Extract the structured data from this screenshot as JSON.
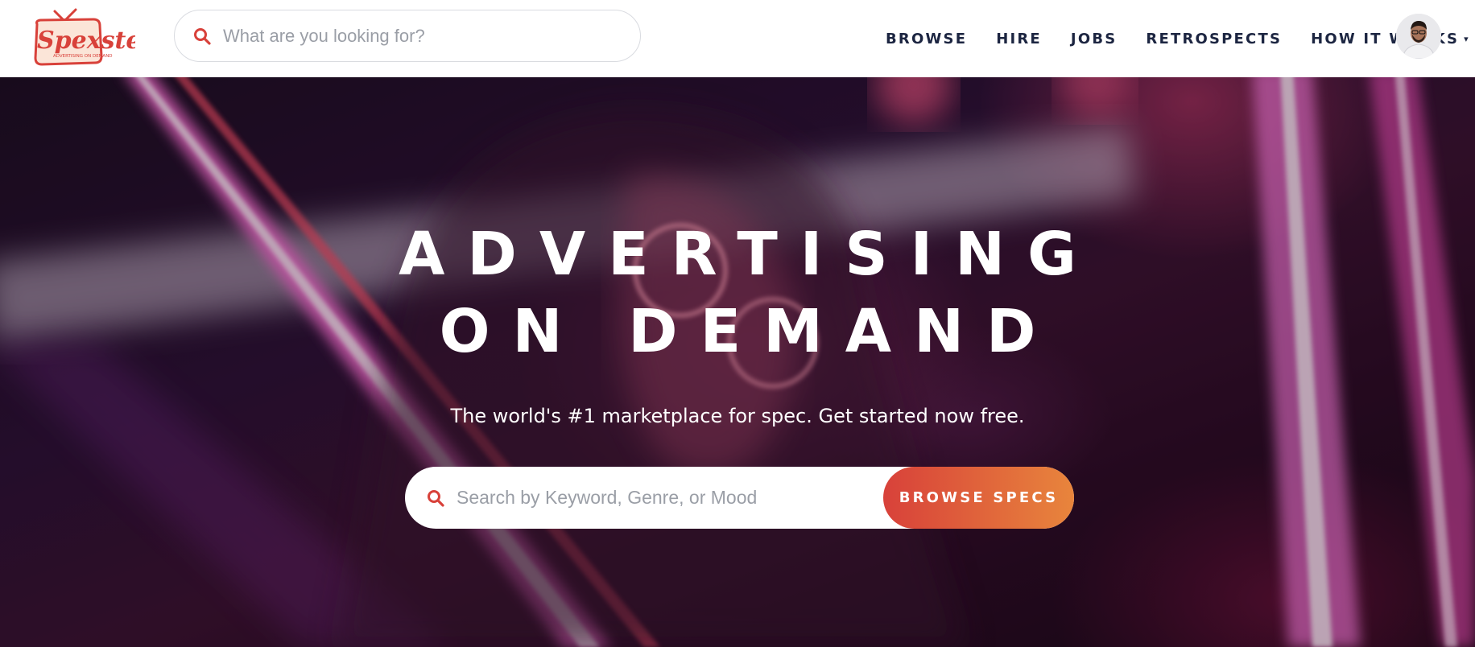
{
  "brand": {
    "name": "Spexster",
    "tagline": "ADVERTISING ON DEMAND",
    "primary_color": "#d8413a",
    "accent_color": "#e8853c",
    "nav_text_color": "#1c2541"
  },
  "header": {
    "search": {
      "placeholder": "What are you looking for?",
      "icon": "search-icon"
    },
    "nav": [
      {
        "label": "BROWSE"
      },
      {
        "label": "HIRE"
      },
      {
        "label": "JOBS"
      },
      {
        "label": "RETROSPECTS"
      },
      {
        "label": "HOW IT WORKS",
        "has_dropdown": true,
        "caret": "▾"
      }
    ],
    "avatar": {
      "icon": "user-avatar"
    }
  },
  "hero": {
    "title_line1": "ADVERTISING",
    "title_line2": "ON DEMAND",
    "subtitle": "The world's #1 marketplace for spec. Get started now free.",
    "search": {
      "placeholder": "Search by Keyword, Genre, or Mood",
      "icon": "search-icon"
    },
    "cta_label": "BROWSE SPECS"
  }
}
